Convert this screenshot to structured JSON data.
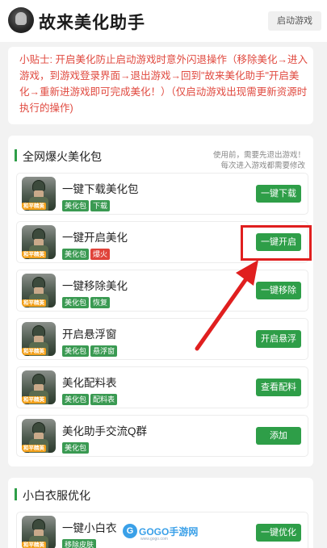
{
  "header": {
    "title": "故来美化助手",
    "launch_label": "启动游戏"
  },
  "tip": {
    "text": "小贴士: 开启美化防止启动游戏时意外闪退操作（移除美化→进入游戏，到游戏登录界面→退出游戏→回到\"故来美化助手\"开启美化→重新进游戏即可完成美化！）（仅启动游戏出现需更新资源时执行的操作)"
  },
  "section1": {
    "title": "全网爆火美化包",
    "note_line1": "使用前，需要先退出游戏！",
    "note_line2": "每次进入游戏都需要修改",
    "rows": [
      {
        "title": "一键下载美化包",
        "tags": [
          "美化包",
          "下载"
        ],
        "button": "一键下载"
      },
      {
        "title": "一键开启美化",
        "tags": [
          "美化包",
          "爆火"
        ],
        "button": "一键开启"
      },
      {
        "title": "一键移除美化",
        "tags": [
          "美化包",
          "恢复"
        ],
        "button": "一键移除"
      },
      {
        "title": "开启悬浮窗",
        "tags": [
          "美化包",
          "悬浮窗"
        ],
        "button": "开启悬浮"
      },
      {
        "title": "美化配料表",
        "tags": [
          "美化包",
          "配料表"
        ],
        "button": "查看配料"
      },
      {
        "title": "美化助手交流Q群",
        "tags": [
          "美化包"
        ],
        "button": "添加"
      }
    ]
  },
  "section2": {
    "title": "小白衣服优化",
    "rows": [
      {
        "title": "一键小白衣",
        "tags": [
          "移除皮肤"
        ],
        "button": "一键优化"
      }
    ]
  },
  "icon_badge": "和平精英",
  "watermark": {
    "brand": "GOGO手游网",
    "letter": "G",
    "sub": "www.gogo.com"
  },
  "colors": {
    "accent_green": "#2e9e48",
    "tip_red": "#e0493f",
    "highlight_red": "#e01f1f"
  }
}
